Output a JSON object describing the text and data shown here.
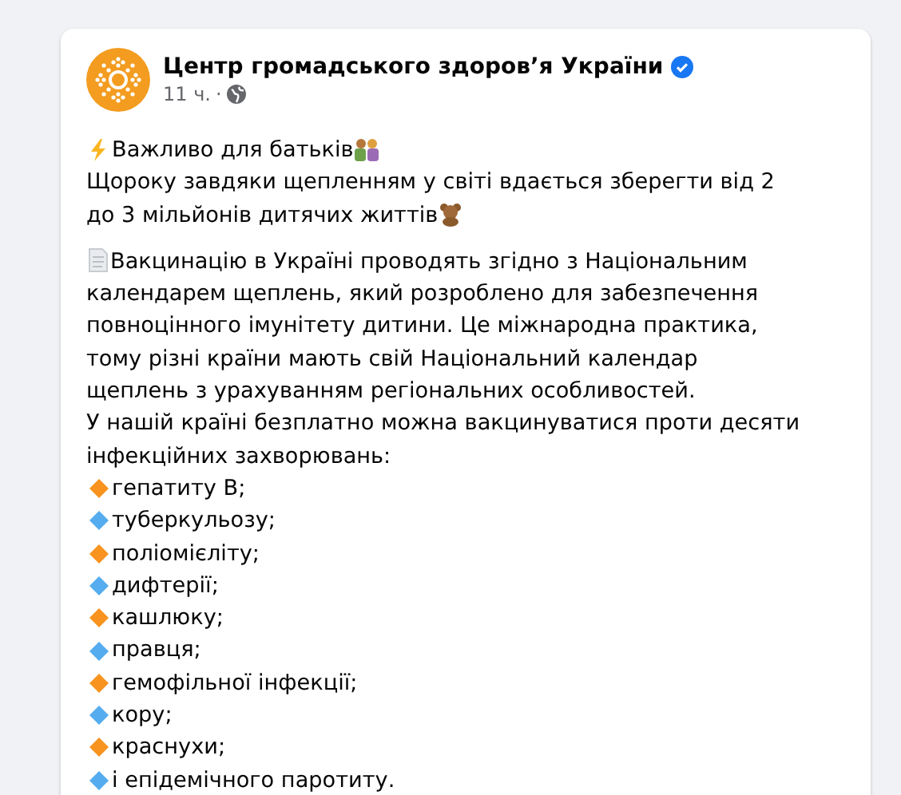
{
  "post": {
    "author": "Центр громадського здоров’я України",
    "verified": true,
    "time": "11 ч.",
    "audience_separator": "·",
    "headline": "Важливо для батьків",
    "intro": "Щороку завдяки щепленням у світі вдається зберегти від 2 до 3 мільйонів дитячих життів",
    "paragraph": "Вакцинацію в Україні проводять згідно з Національним календарем щеплень, який розроблено для забезпечення повноцінного імунітету дитини. Це міжнародна практика, тому різні країни мають свій Національний календар щеплень з урахуванням регіональних особливостей.",
    "list_intro": "У нашій країні безплатно можна вакцинуватися проти десяти інфекційних захворювань:",
    "items": [
      {
        "text": "гепатиту В;",
        "color": "#f7931e"
      },
      {
        "text": "туберкульозу;",
        "color": "#55acee"
      },
      {
        "text": "поліомієліту;",
        "color": "#f7931e"
      },
      {
        "text": "дифтерії;",
        "color": "#55acee"
      },
      {
        "text": "кашлюку;",
        "color": "#f7931e"
      },
      {
        "text": "правця;",
        "color": "#55acee"
      },
      {
        "text": "гемофільної інфекції;",
        "color": "#f7931e"
      },
      {
        "text": "кору;",
        "color": "#55acee"
      },
      {
        "text": "краснухи;",
        "color": "#f7931e"
      },
      {
        "text": "і епідемічного паротиту.",
        "color": "#55acee"
      }
    ]
  }
}
